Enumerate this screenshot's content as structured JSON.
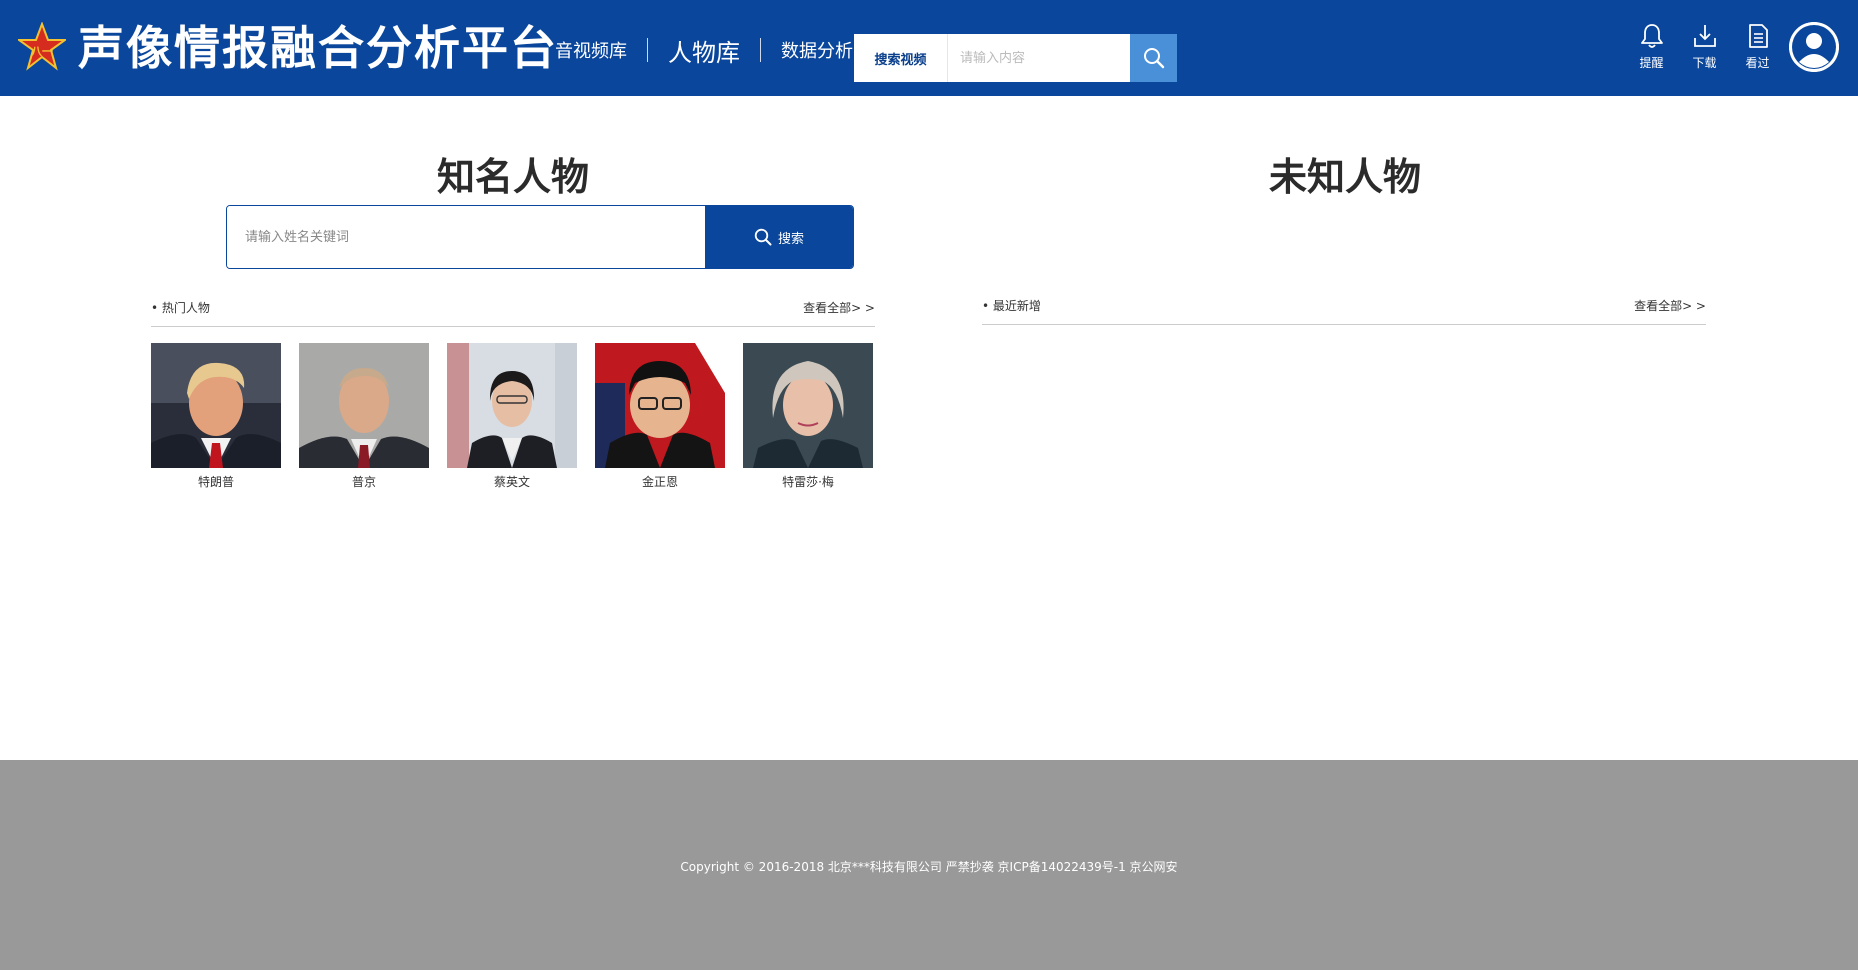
{
  "header": {
    "brand_title": "声像情报融合分析平台",
    "nav": [
      {
        "label": "音视频库",
        "active": false
      },
      {
        "label": "人物库",
        "active": true
      },
      {
        "label": "数据分析",
        "active": false
      }
    ],
    "search": {
      "type_label": "搜索视频",
      "placeholder": "请输入内容"
    },
    "icons": [
      {
        "icon": "bell-icon",
        "label": "提醒"
      },
      {
        "icon": "download-icon",
        "label": "下载"
      },
      {
        "icon": "document-icon",
        "label": "看过"
      }
    ],
    "colors": {
      "bar": "#0a479c",
      "search_button": "#4a90d9"
    }
  },
  "known": {
    "title": "知名人物",
    "search_placeholder": "请输入姓名关键词",
    "search_button": "搜索",
    "hot_label": "• 热门人物",
    "view_all": "查看全部> >",
    "people": [
      {
        "name": "特朗普"
      },
      {
        "name": "普京"
      },
      {
        "name": "蔡英文"
      },
      {
        "name": "金正恩"
      },
      {
        "name": "特雷莎·梅"
      }
    ]
  },
  "unknown": {
    "title": "未知人物",
    "recent_label": "• 最近新增",
    "view_all": "查看全部> >"
  },
  "footer": {
    "copyright": "Copyright © 2016-2018 北京***科技有限公司 严禁抄袭 京ICP备14022439号-1 京公网安"
  }
}
